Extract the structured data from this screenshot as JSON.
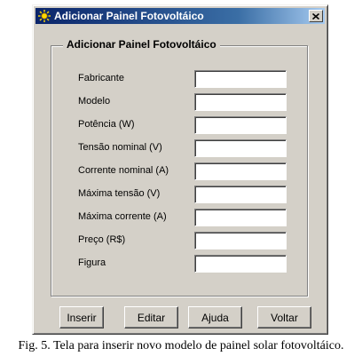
{
  "window": {
    "title": "Adicionar Painel Fotovoltáico",
    "close_label": "x"
  },
  "group": {
    "title": "Adicionar Painel Fotovoltáico"
  },
  "fields": [
    {
      "label": "Fabricante",
      "value": ""
    },
    {
      "label": "Modelo",
      "value": ""
    },
    {
      "label": "Potência (W)",
      "value": ""
    },
    {
      "label": "Tensão nominal (V)",
      "value": ""
    },
    {
      "label": "Corrente nominal (A)",
      "value": ""
    },
    {
      "label": "Máxima tensão (V)",
      "value": ""
    },
    {
      "label": "Máxima corrente (A)",
      "value": ""
    },
    {
      "label": "Preço (R$)",
      "value": ""
    },
    {
      "label": "Figura",
      "value": ""
    }
  ],
  "buttons": {
    "inserir": "Inserir",
    "editar": "Editar",
    "ajuda": "Ajuda",
    "voltar": "Voltar"
  },
  "caption": "Fig. 5. Tela para inserir novo modelo de painel solar fotovoltáico.",
  "colors": {
    "titlebar": "#0a246a",
    "face": "#d4d0c8"
  },
  "icons": {
    "app": "solar-panel-icon",
    "close": "close-icon"
  }
}
